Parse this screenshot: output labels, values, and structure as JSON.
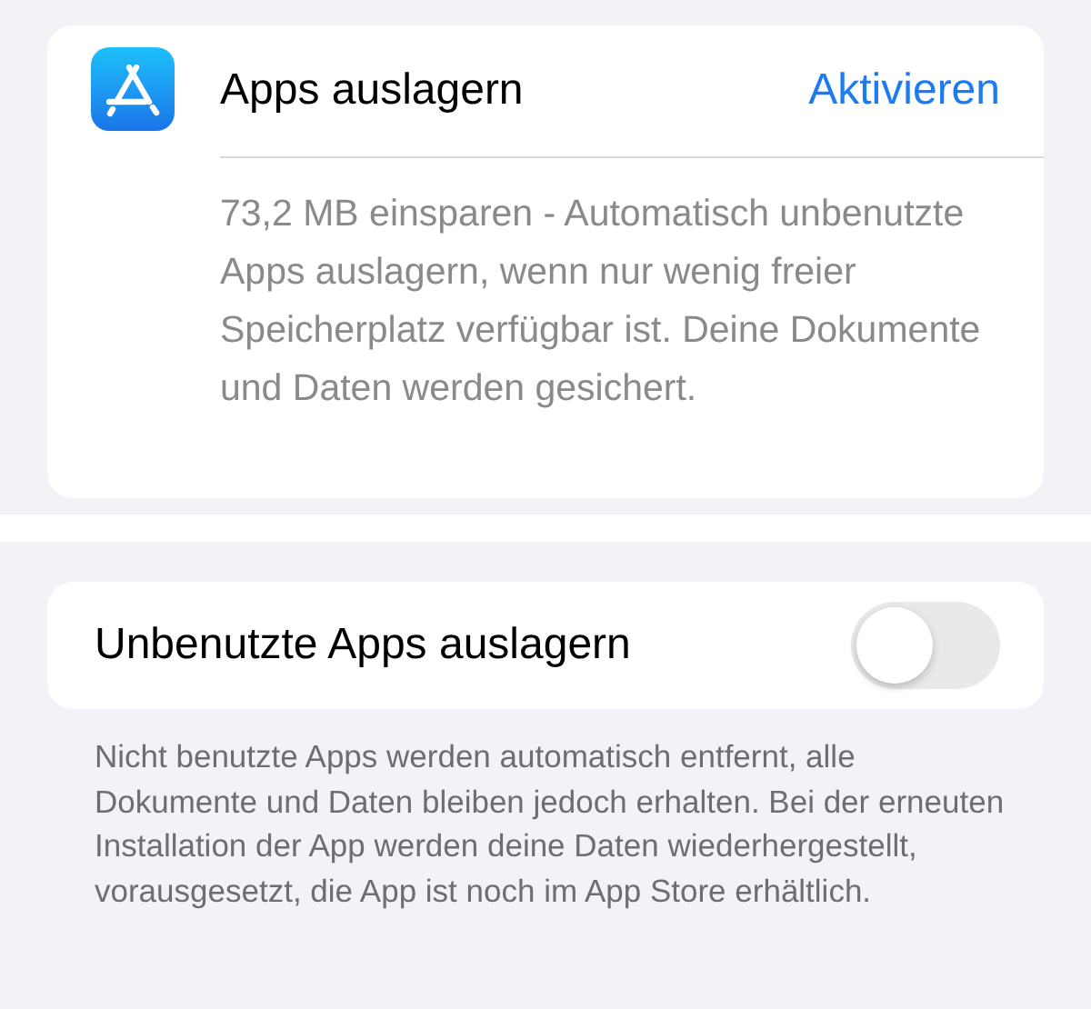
{
  "offload_card": {
    "title": "Apps auslagern",
    "action": "Aktivieren",
    "description": "73,2 MB einsparen - Automatisch unbenutzte Apps auslagern, wenn nur wenig freier Speicherplatz verfügbar ist. Deine Dokumente und Daten werden gesichert."
  },
  "auto_offload": {
    "label": "Unbenutzte Apps auslagern",
    "on": false
  },
  "footer": "Nicht benutzte Apps werden automatisch entfernt, alle Dokumente und Daten bleiben jedoch erhalten. Bei der erneuten Installation der App werden deine Daten wiederhergestellt, vorausgesetzt, die App ist noch im App Store erhältlich."
}
